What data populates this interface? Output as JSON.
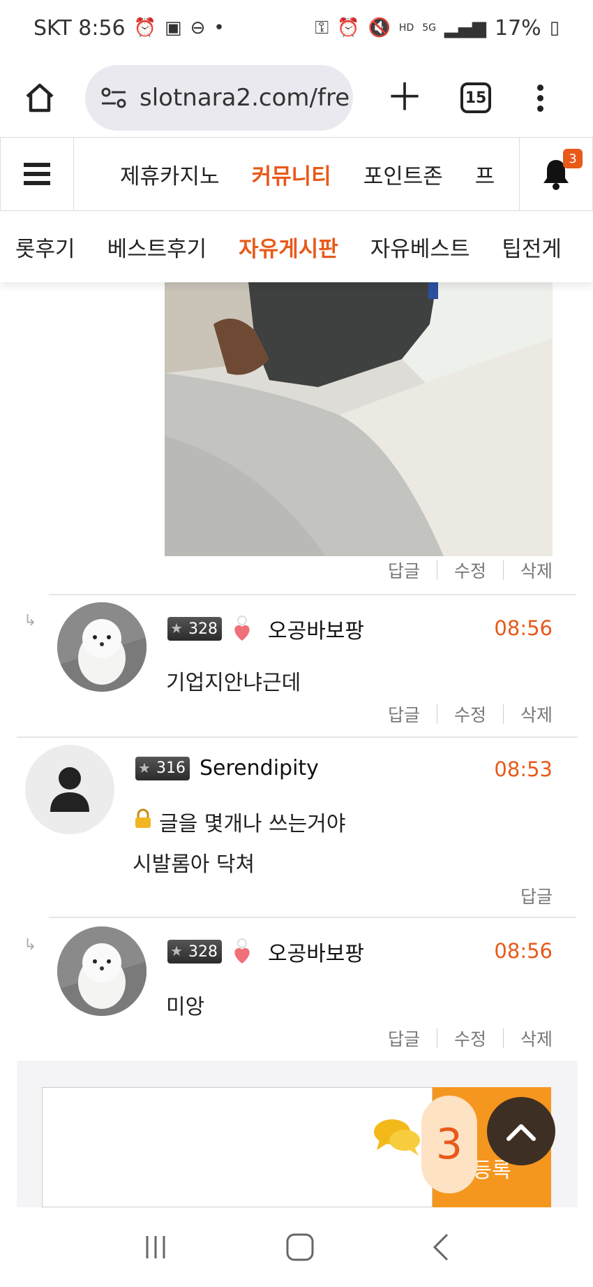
{
  "status_bar": {
    "carrier_time": "SKT 8:56",
    "battery": "17%",
    "tabs_count": "15"
  },
  "browser": {
    "url": "slotnara2.com/fre"
  },
  "site_nav": {
    "items": [
      "제휴카지노",
      "커뮤니티",
      "포인트존",
      "프"
    ],
    "active_index": 1,
    "notification_count": "3"
  },
  "sub_nav": {
    "items": [
      "롯후기",
      "베스트후기",
      "자유게시판",
      "자유베스트",
      "팁전게"
    ],
    "active_index": 2
  },
  "post_actions": {
    "reply": "답글",
    "edit": "수정",
    "delete": "삭제"
  },
  "comments": [
    {
      "level": "328",
      "author": "오공바보팡",
      "time": "08:56",
      "text": "기업지안냐근데",
      "actions": [
        "답글",
        "수정",
        "삭제"
      ]
    },
    {
      "level": "316",
      "author": "Serendipity",
      "time": "08:53",
      "text_line1": "글을 몇개나 쓰는거야",
      "text_line2": "시발롬아 닥쳐",
      "actions": [
        "답글"
      ]
    },
    {
      "level": "328",
      "author": "오공바보팡",
      "time": "08:56",
      "text": "미앙",
      "actions": [
        "답글",
        "수정",
        "삭제"
      ]
    }
  ],
  "comment_form": {
    "submit_label": "등록",
    "chat_count": "3"
  },
  "colors": {
    "accent": "#e8591a",
    "submit_bg": "#f5961e",
    "scrolltop_bg": "#3e2f24"
  }
}
